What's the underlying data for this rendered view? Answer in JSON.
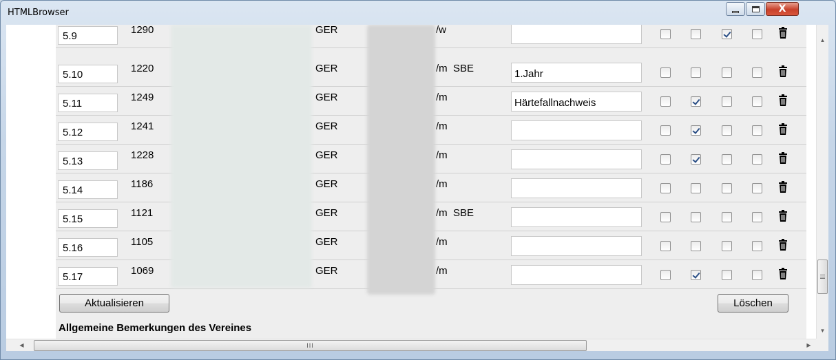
{
  "window": {
    "title": "HTMLBrowser",
    "close_glyph": "X"
  },
  "rows": [
    {
      "pos": "5.9",
      "num": "1290",
      "nat": "GER",
      "cat": "/w",
      "note": "",
      "checks": [
        false,
        false,
        true,
        false
      ]
    },
    {
      "pos": "5.10",
      "num": "1220",
      "nat": "GER",
      "cat": "/m  SBE",
      "note": "1.Jahr",
      "checks": [
        false,
        false,
        false,
        false
      ]
    },
    {
      "pos": "5.11",
      "num": "1249",
      "nat": "GER",
      "cat": "/m",
      "note": "Härtefallnachweis",
      "checks": [
        false,
        true,
        false,
        false
      ]
    },
    {
      "pos": "5.12",
      "num": "1241",
      "nat": "GER",
      "cat": "/m",
      "note": "",
      "checks": [
        false,
        true,
        false,
        false
      ]
    },
    {
      "pos": "5.13",
      "num": "1228",
      "nat": "GER",
      "cat": "/m",
      "note": "",
      "checks": [
        false,
        true,
        false,
        false
      ]
    },
    {
      "pos": "5.14",
      "num": "1186",
      "nat": "GER",
      "cat": "/m",
      "note": "",
      "checks": [
        false,
        false,
        false,
        false
      ]
    },
    {
      "pos": "5.15",
      "num": "1121",
      "nat": "GER",
      "cat": "/m  SBE",
      "note": "",
      "checks": [
        false,
        false,
        false,
        false
      ]
    },
    {
      "pos": "5.16",
      "num": "1105",
      "nat": "GER",
      "cat": "/m",
      "note": "",
      "checks": [
        false,
        false,
        false,
        false
      ]
    },
    {
      "pos": "5.17",
      "num": "1069",
      "nat": "GER",
      "cat": "/m",
      "note": "",
      "checks": [
        false,
        true,
        false,
        false
      ]
    }
  ],
  "actions": {
    "update_label": "Aktualisieren",
    "delete_label": "Löschen"
  },
  "remarks": {
    "title": "Allgemeine Bemerkungen des Vereines"
  },
  "scrollbar": {
    "h_grip": "III"
  },
  "colors": {
    "check_mark": "#2b4f86",
    "close_button": "#c8412b"
  }
}
